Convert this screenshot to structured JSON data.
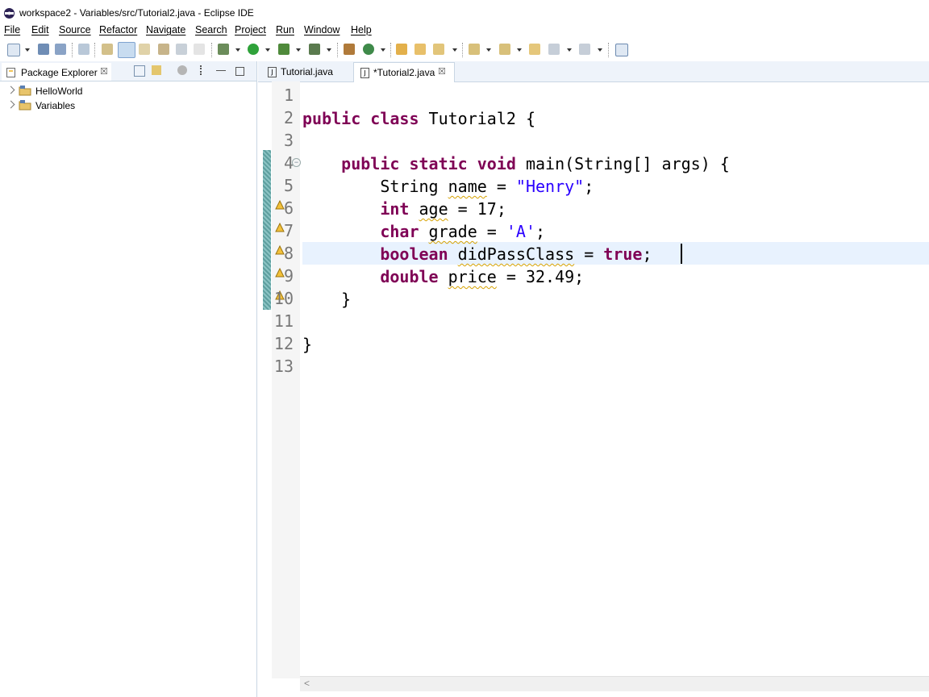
{
  "window": {
    "title": "workspace2 - Variables/src/Tutorial2.java - Eclipse IDE"
  },
  "menu": [
    "File",
    "Edit",
    "Source",
    "Refactor",
    "Navigate",
    "Search",
    "Project",
    "Run",
    "Window",
    "Help"
  ],
  "package_explorer": {
    "tab_label": "Package Explorer",
    "close_glyph": "☒",
    "projects": [
      "HelloWorld",
      "Variables"
    ]
  },
  "editor": {
    "tabs": [
      {
        "label": "Tutorial.java",
        "active": false
      },
      {
        "label": "*Tutorial2.java",
        "active": true,
        "close_glyph": "☒"
      }
    ],
    "line_numbers": [
      "1",
      "2",
      "3",
      "4",
      "5",
      "6",
      "7",
      "8",
      "9",
      "10",
      "11",
      "12",
      "13"
    ],
    "current_line": 8,
    "code": {
      "l2": {
        "kw1": "public",
        "kw2": "class",
        "rest": " Tutorial2 {"
      },
      "l4": {
        "kw1": "public",
        "kw2": "static",
        "kw3": "void",
        "rest": " main(String[] args) {"
      },
      "l5": {
        "type": "String",
        "var": "name",
        "eq": " = ",
        "val": "\"Henry\"",
        "end": ";"
      },
      "l6": {
        "type": "int",
        "var": "age",
        "rest": " = 17;"
      },
      "l7": {
        "type": "char",
        "var": "grade",
        "eq": " = ",
        "val": "'A'",
        "end": ";"
      },
      "l8": {
        "type": "boolean",
        "var": "didPassClass",
        "eq": " = ",
        "val": "true",
        "end": ";"
      },
      "l9": {
        "type": "double",
        "var": "price",
        "rest": " = 32.49;"
      },
      "l10": "}",
      "l12": "}"
    },
    "scroll_arrow": "<"
  },
  "colors": {
    "keyword": "#7f0055",
    "string": "#2a00ff",
    "line_number": "#787878",
    "current_line": "#e8f2fe"
  }
}
